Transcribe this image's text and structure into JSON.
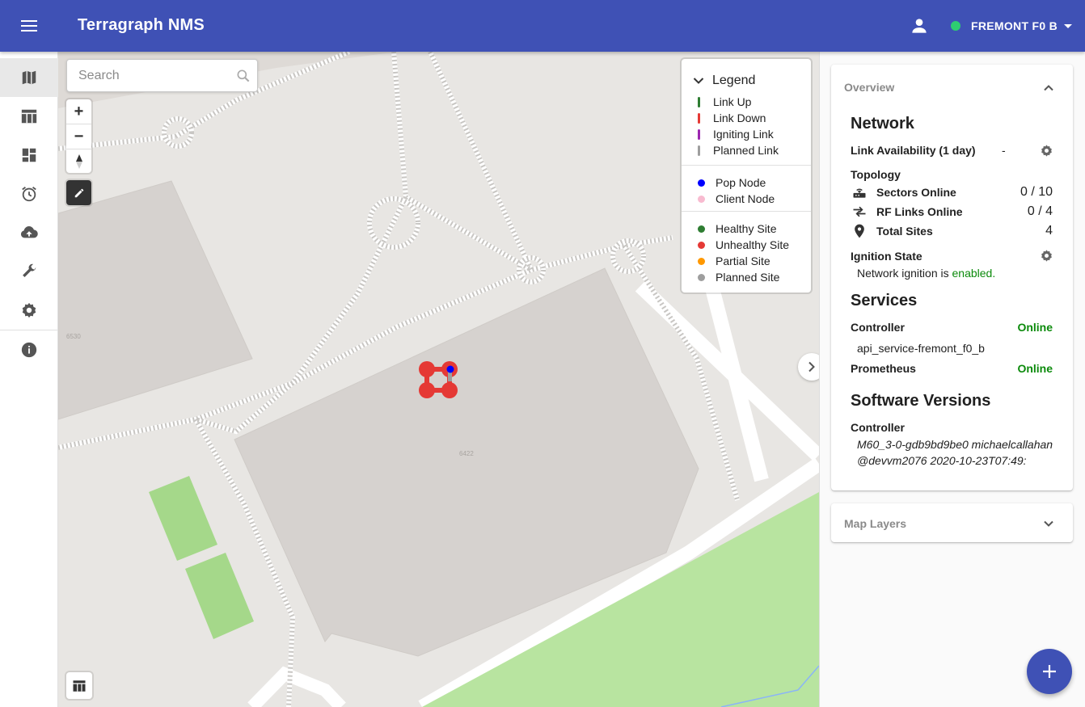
{
  "app": {
    "title": "Terragraph NMS"
  },
  "network_selector": {
    "name": "FREMONT F0 B",
    "status_color": "#2ecc71"
  },
  "nav": {
    "items": [
      {
        "name": "map",
        "icon": "map-icon",
        "active": true
      },
      {
        "name": "tables",
        "icon": "table-icon"
      },
      {
        "name": "dashboards",
        "icon": "dashboard-icon"
      },
      {
        "name": "events",
        "icon": "alarm-clock-icon"
      },
      {
        "name": "upgrade",
        "icon": "cloud-upload-icon"
      },
      {
        "name": "config",
        "icon": "wrench-icon"
      },
      {
        "name": "settings",
        "icon": "gear-icon"
      },
      {
        "name": "about",
        "icon": "info-icon"
      }
    ]
  },
  "map": {
    "search_placeholder": "Search",
    "zoom_in": "+",
    "zoom_out": "−",
    "building_labels": [
      "6530",
      "6422"
    ]
  },
  "legend": {
    "title": "Legend",
    "links": [
      {
        "label": "Link Up",
        "color": "#2e7d32"
      },
      {
        "label": "Link Down",
        "color": "#e53935"
      },
      {
        "label": "Igniting Link",
        "color": "#9c27b0"
      },
      {
        "label": "Planned Link",
        "color": "#9e9e9e"
      }
    ],
    "nodes": [
      {
        "label": "Pop Node",
        "color": "#0000ff"
      },
      {
        "label": "Client Node",
        "color": "#f8bbd0"
      }
    ],
    "sites": [
      {
        "label": "Healthy Site",
        "color": "#2e7d32"
      },
      {
        "label": "Unhealthy Site",
        "color": "#e53935"
      },
      {
        "label": "Partial Site",
        "color": "#ff9800"
      },
      {
        "label": "Planned Site",
        "color": "#9e9e9e"
      }
    ]
  },
  "overview": {
    "header": "Overview",
    "network": {
      "title": "Network",
      "link_availability_label": "Link Availability (1 day)",
      "link_availability_value": "-",
      "topology_label": "Topology",
      "sectors_label": "Sectors Online",
      "sectors_value": "0 / 10",
      "rf_links_label": "RF Links Online",
      "rf_links_value": "0 / 4",
      "sites_label": "Total Sites",
      "sites_value": "4",
      "ignition_label": "Ignition State",
      "ignition_text": "Network ignition is ",
      "ignition_status": "enabled",
      "ignition_period": "."
    },
    "services": {
      "title": "Services",
      "controller_label": "Controller",
      "controller_status": "Online",
      "controller_name": "api_service-fremont_f0_b",
      "prometheus_label": "Prometheus",
      "prometheus_status": "Online"
    },
    "software": {
      "title": "Software Versions",
      "controller_label": "Controller",
      "controller_version_line1": "M60_3-0-gdb9bd9be0 michaelcallahan",
      "controller_version_line2": "@devvm2076 2020-10-23T07:49:"
    }
  },
  "map_layers": {
    "header": "Map Layers"
  },
  "colors": {
    "primary": "#3f51b5",
    "online": "#0b8a0b",
    "site_unhealthy": "#e53935"
  }
}
